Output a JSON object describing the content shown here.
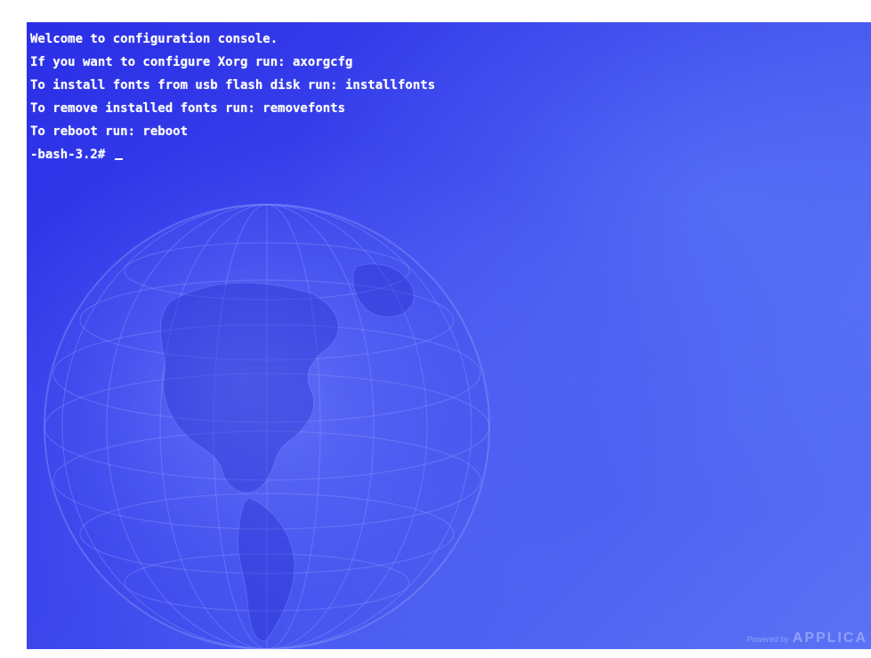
{
  "console": {
    "lines": [
      "Welcome to configuration console.",
      "If you want to configure Xorg run: axorgcfg",
      "To install fonts from usb flash disk run: installfonts",
      "To remove installed fonts run: removefonts",
      "To reboot run: reboot"
    ],
    "prompt": "-bash-3.2# "
  },
  "watermark": {
    "prefix": "Powered by",
    "brand": "APPLICA"
  },
  "theme": {
    "background": "#3a44ec",
    "text": "#ffffff"
  },
  "decoration": {
    "icon": "globe-icon"
  }
}
